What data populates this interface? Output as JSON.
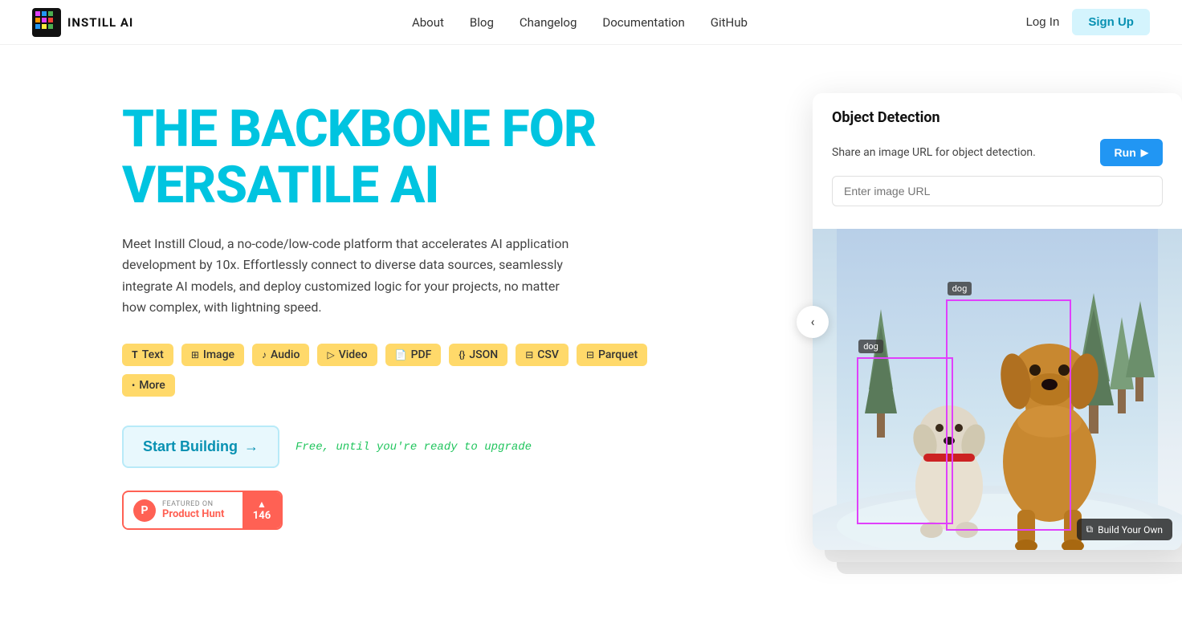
{
  "nav": {
    "logo_text": "INSTILL AI",
    "links": [
      {
        "label": "About",
        "id": "about"
      },
      {
        "label": "Blog",
        "id": "blog"
      },
      {
        "label": "Changelog",
        "id": "changelog"
      },
      {
        "label": "Documentation",
        "id": "docs"
      },
      {
        "label": "GitHub",
        "id": "github"
      }
    ],
    "login_label": "Log In",
    "signup_label": "Sign Up"
  },
  "hero": {
    "title_line1": "THE BACKBONE FOR",
    "title_line2": "VERSATILE AI",
    "description": "Meet Instill Cloud, a no-code/low-code platform that accelerates AI application development by 10x. Effortlessly connect to diverse data sources, seamlessly integrate AI models, and deploy customized logic for your projects, no matter how complex, with lightning speed.",
    "tags": [
      {
        "label": "Text",
        "icon": "T"
      },
      {
        "label": "Image",
        "icon": "⊞"
      },
      {
        "label": "Audio",
        "icon": "⊟"
      },
      {
        "label": "Video",
        "icon": "▷"
      },
      {
        "label": "PDF",
        "icon": "⊟"
      },
      {
        "label": "JSON",
        "icon": "{}"
      },
      {
        "label": "CSV",
        "icon": "⊟"
      },
      {
        "label": "Parquet",
        "icon": "⊟"
      },
      {
        "label": "More",
        "icon": "•"
      }
    ],
    "start_building_label": "Start Building",
    "start_arrow": "→",
    "free_text": "Free, until you're ready to upgrade",
    "ph_featured": "FEATURED ON",
    "ph_name": "Product Hunt",
    "ph_count": "146",
    "ph_arrow": "▲"
  },
  "demo": {
    "title": "Object Detection",
    "description": "Share an image URL for object detection.",
    "run_label": "Run",
    "input_placeholder": "Enter image URL",
    "bbox1_label": "dog",
    "bbox2_label": "dog",
    "footer_label": "Build Your Own",
    "carousel_prev": "‹"
  }
}
